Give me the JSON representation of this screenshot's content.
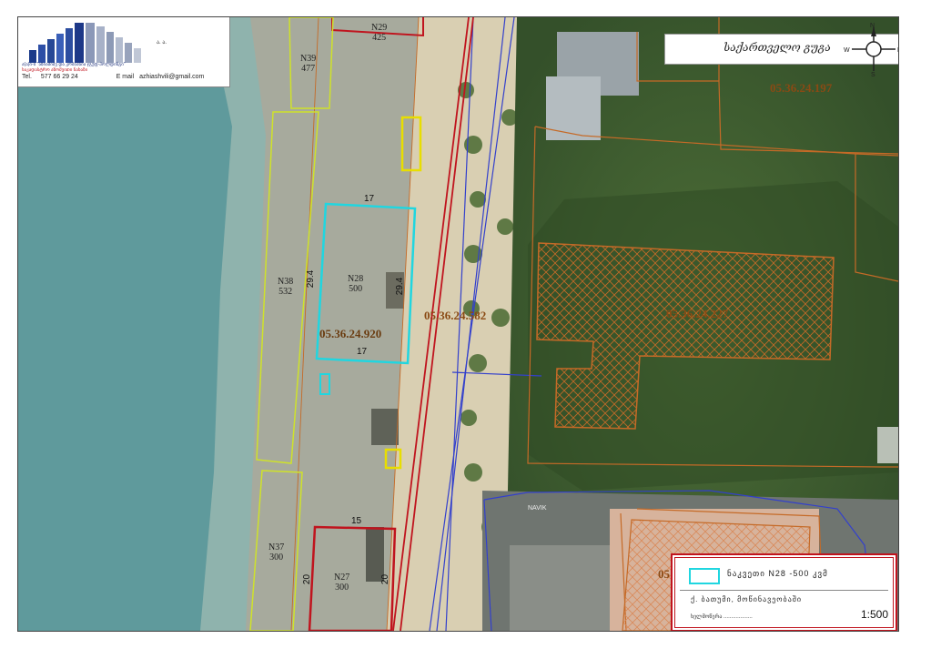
{
  "header": {
    "company_lines": [
      "ა(ა)ი-ს \"აზიაშიძე და კომპანია ჯგუფ-ჰოლდინგი\"",
      "საკადასტრო აზომვითი ნახაზი"
    ],
    "marks": "ა. ა.",
    "phone_label": "Tel.",
    "phone": "577 66 29 24",
    "email_label": "E mail",
    "email": "azhiashvili@gmail.com"
  },
  "compass": {
    "signature": "საქართველო გუგა",
    "directions": {
      "n": "N",
      "s": "S",
      "e": "E",
      "w": "W"
    }
  },
  "parcels": {
    "n29": {
      "num": "N29",
      "area": "425"
    },
    "n39": {
      "num": "N39",
      "area": "477"
    },
    "n38": {
      "num": "N38",
      "area": "532"
    },
    "n28": {
      "num": "N28",
      "area": "500"
    },
    "n37": {
      "num": "N37",
      "area": "300"
    },
    "n27": {
      "num": "N27",
      "area": "300"
    }
  },
  "dimensions": {
    "top17": "17",
    "bottom17": "17",
    "left294": "29.4",
    "right294": "29.4",
    "top15": "15",
    "left20": "20",
    "right20": "20"
  },
  "cadastral_codes": {
    "c197": "05.36.24.197",
    "c227": "05.36.24.227",
    "c582": "05.36.24.582",
    "c920": "05.36.24.920",
    "c05": "05"
  },
  "street_label": "NAVIK",
  "legend": {
    "item": "ნაკვეთი N28 -500 კვმ",
    "author": "ქ. ბათუმი, მოწინავეობაში",
    "signature_line": "ხელმოწერა ...................",
    "scale": "1:500",
    "swatch_color": "#20d6e0"
  },
  "colors": {
    "sea": "#5f9a9c",
    "beach": "#a7aa9d",
    "promenade": "#d9cfb2",
    "vegetation": "#41602f",
    "red_line": "#c0141e",
    "blue_line": "#3340cc",
    "yellow_line": "#cfe22a",
    "cyan_line": "#20d6e0",
    "orange_line": "#c56a27"
  }
}
